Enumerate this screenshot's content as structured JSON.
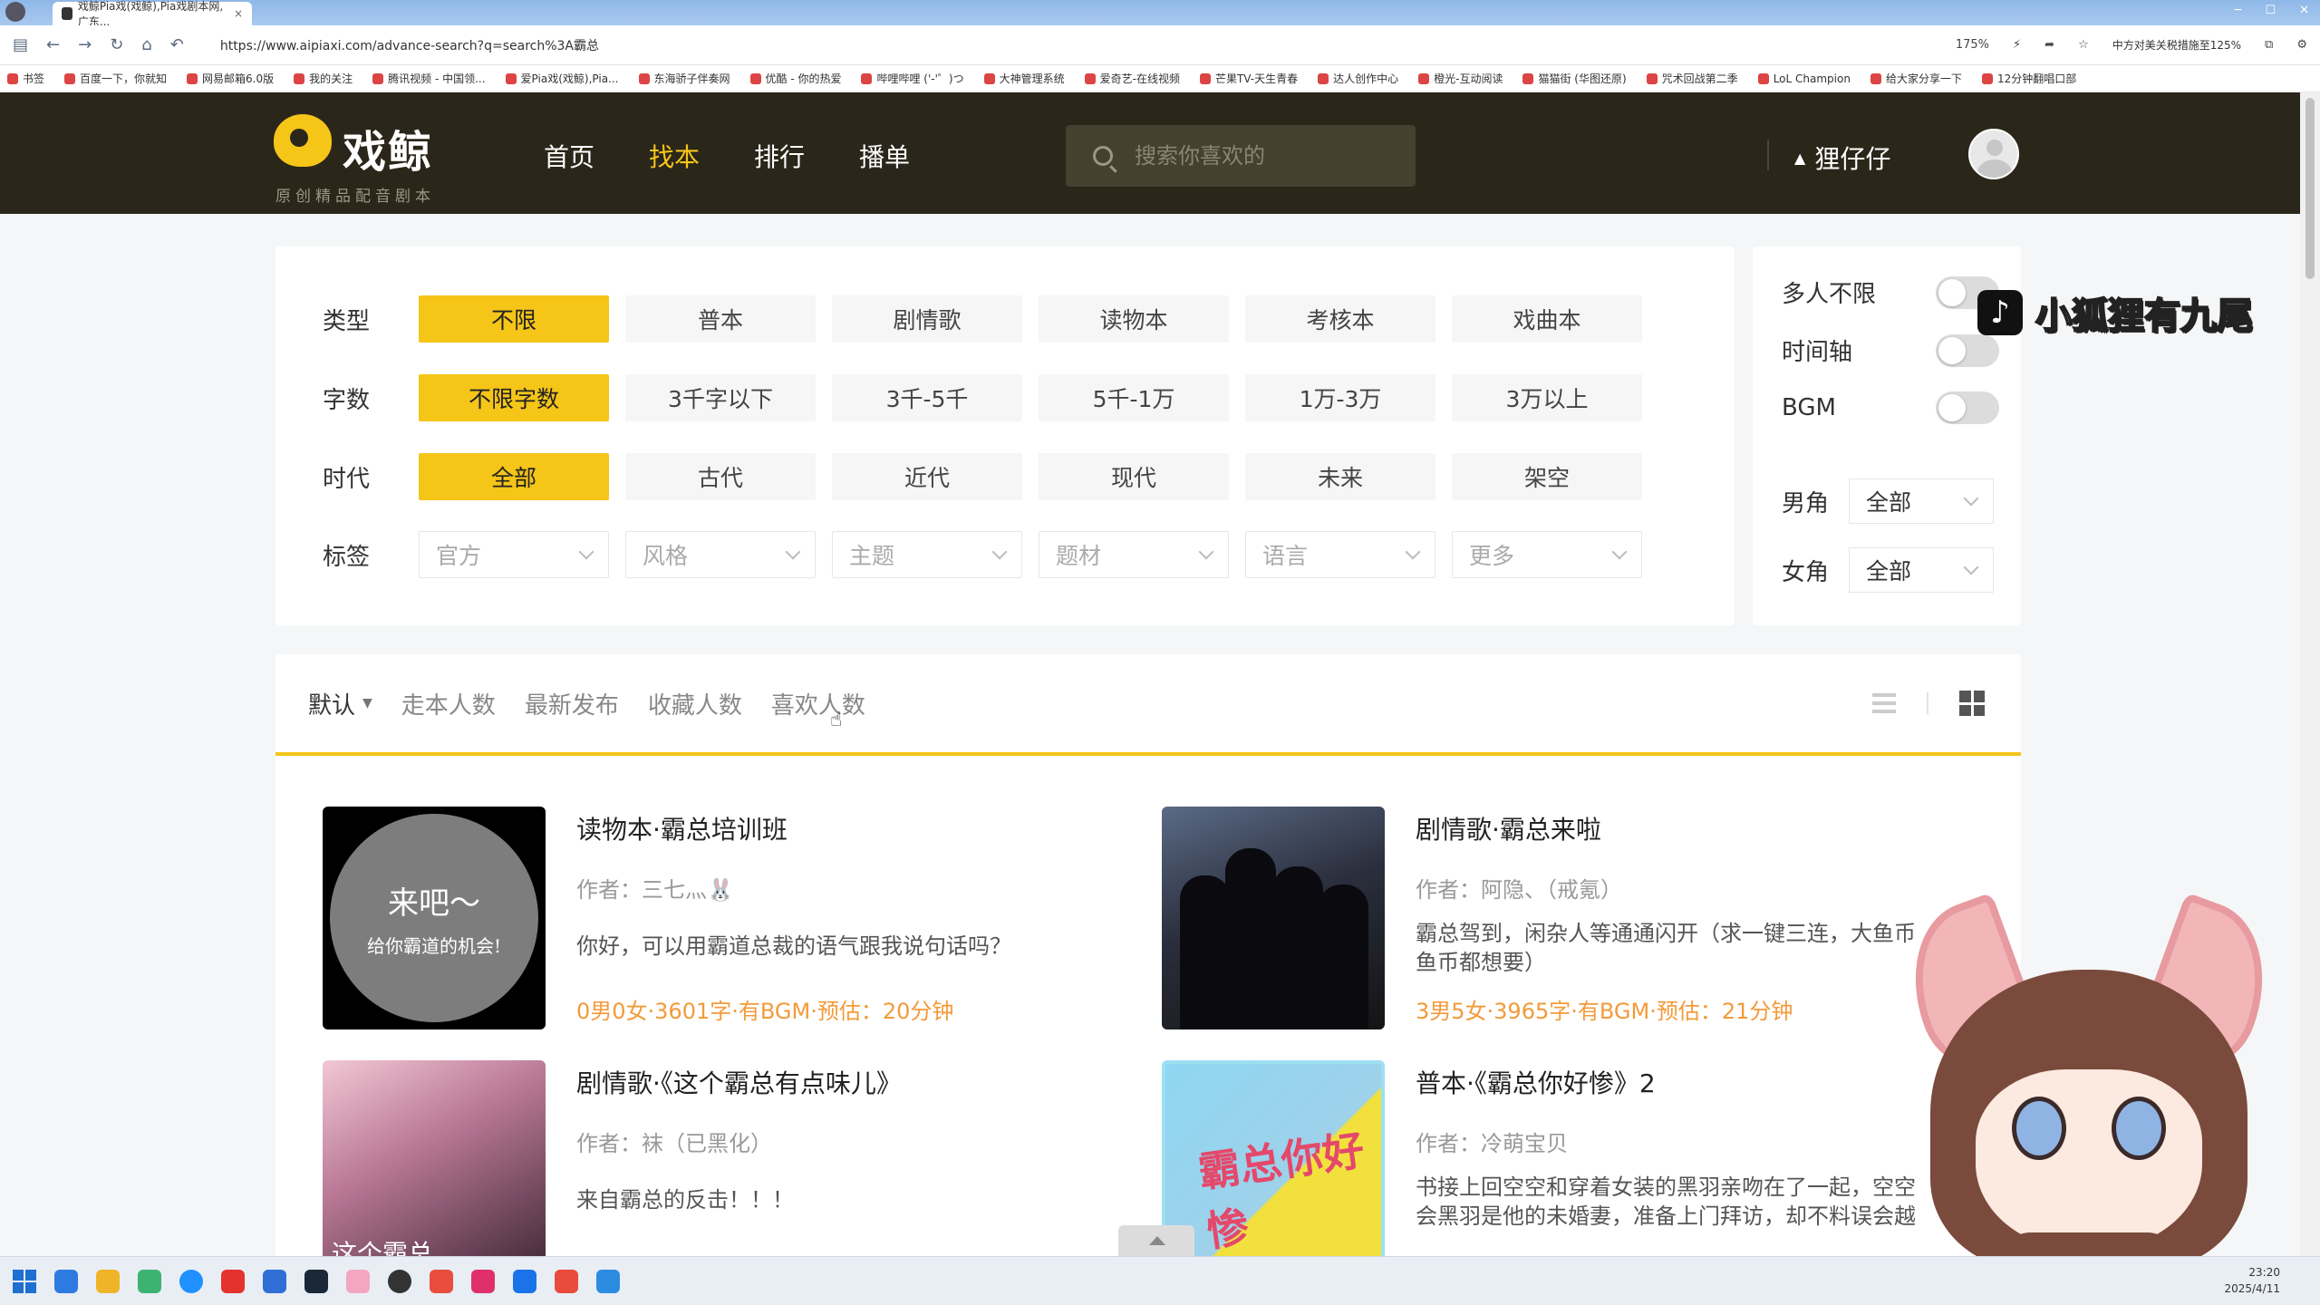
{
  "browser": {
    "tab_title": "戏鲸Pia戏(戏鲸),Pia戏剧本网,广东...",
    "url": "https://www.aipiaxi.com/advance-search?q=search%3A霸总",
    "zoom": "175%",
    "promo": "中方对美关税措施至125%",
    "bookmarks": [
      "书签",
      "百度一下，你就知",
      "网易邮箱6.0版",
      "我的关注",
      "腾讯视频 - 中国领...",
      "爱Pia戏(戏鲸),Pia...",
      "东海骄子伴奏网",
      "优酷 - 你的热爱",
      "哔哩哔哩 ('-'゜)つ",
      "大神管理系统",
      "爱奇艺-在线视频",
      "芒果TV-天生青春",
      "达人创作中心",
      "橙光-互动阅读",
      "猫猫街 (华图还原)",
      "咒术回战第二季",
      "LoL Champion",
      "给大家分享一下",
      "12分钟翻唱口部"
    ]
  },
  "site": {
    "logo_text": "戏鲸",
    "logo_sub": "原创精品配音剧本",
    "nav": [
      {
        "label": "首页",
        "active": false
      },
      {
        "label": "找本",
        "active": true
      },
      {
        "label": "排行",
        "active": false
      },
      {
        "label": "播单",
        "active": false
      }
    ],
    "search_placeholder": "搜索你喜欢的",
    "user_name": "狸仔仔",
    "accent_color": "#f5c518"
  },
  "filters": {
    "type": {
      "label": "类型",
      "options": [
        "不限",
        "普本",
        "剧情歌",
        "读物本",
        "考核本",
        "戏曲本"
      ],
      "selected": 0
    },
    "words": {
      "label": "字数",
      "options": [
        "不限字数",
        "3千字以下",
        "3千-5千",
        "5千-1万",
        "1万-3万",
        "3万以上"
      ],
      "selected": 0
    },
    "era": {
      "label": "时代",
      "options": [
        "全部",
        "古代",
        "近代",
        "现代",
        "未来",
        "架空"
      ],
      "selected": 0
    },
    "tags": {
      "label": "标签",
      "selects": [
        "官方",
        "风格",
        "主题",
        "题材",
        "语言",
        "更多"
      ]
    }
  },
  "side": {
    "toggles": [
      {
        "label": "多人不限",
        "on": false
      },
      {
        "label": "时间轴",
        "on": false
      },
      {
        "label": "BGM",
        "on": false
      }
    ],
    "male": {
      "label": "男角",
      "value": "全部"
    },
    "female": {
      "label": "女角",
      "value": "全部"
    }
  },
  "sort": {
    "items": [
      "默认",
      "走本人数",
      "最新发布",
      "收藏人数",
      "喜欢人数"
    ],
    "active": 0
  },
  "results": [
    {
      "title": "读物本·霸总培训班",
      "author": "作者：三七灬🐰",
      "desc": "你好，可以用霸道总裁的语气跟我说句话吗？",
      "meta": "0男0女·3601字·有BGM·预估：20分钟",
      "thumb_line1": "来吧～",
      "thumb_line2": "给你霸道的机会!"
    },
    {
      "title": "剧情歌·霸总来啦",
      "author": "作者：阿隐、（戒氪）",
      "desc": "霸总驾到，闲杂人等通通闪开（求一键三连，大鱼币鱼币都想要）",
      "meta": "3男5女·3965字·有BGM·预估：21分钟"
    },
    {
      "title": "剧情歌·《这个霸总有点味儿》",
      "author": "作者：袜（已黑化）",
      "desc": "来自霸总的反击！！！",
      "meta": "",
      "thumb_text": "这个霸总"
    },
    {
      "title": "普本·《霸总你好惨》2",
      "author": "作者：冷萌宝贝",
      "desc": "书接上回空空和穿着女装的黑羽亲吻在了一起，空空会黑羽是他的未婚妻，准备上门拜访，却不料误会越",
      "meta": "",
      "thumb_text": "霸总你好惨"
    }
  ],
  "overlay": {
    "watermark": "小狐狸有九尾"
  },
  "system": {
    "time": "23:20",
    "date": "2025/4/11"
  }
}
